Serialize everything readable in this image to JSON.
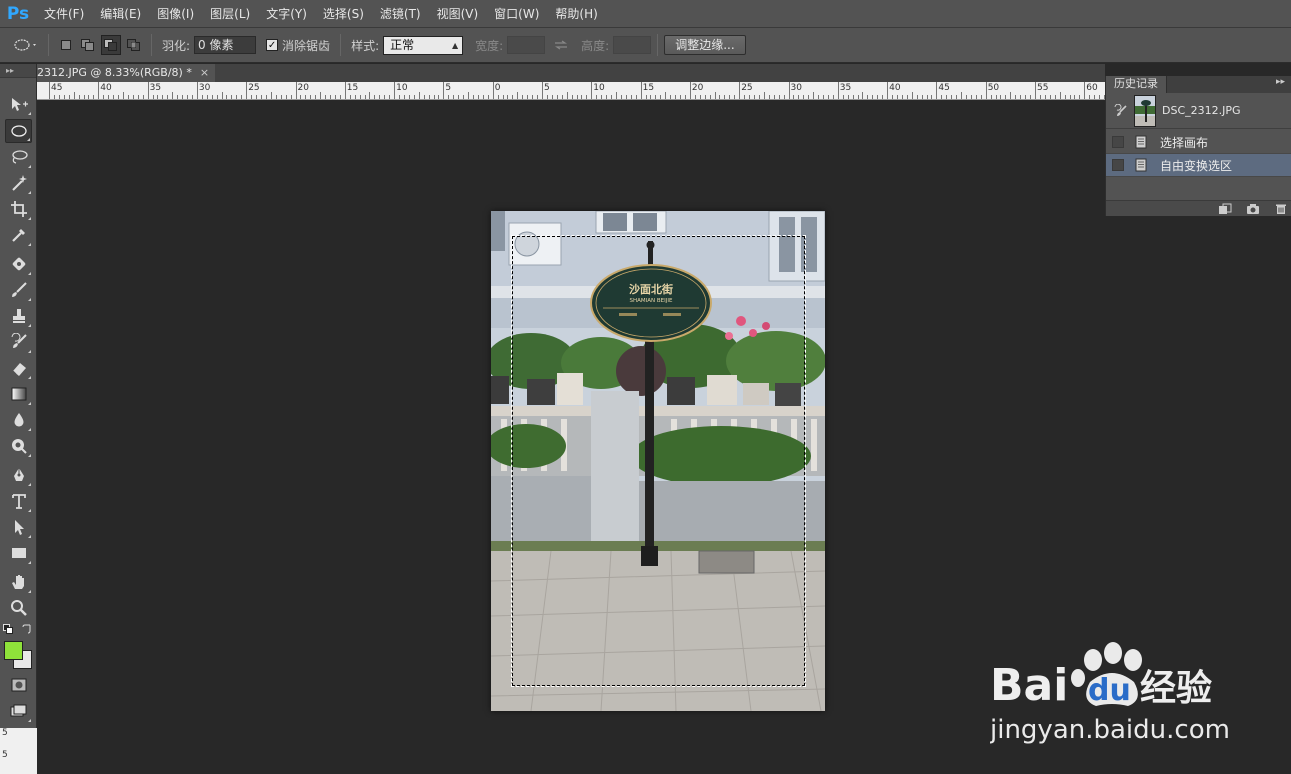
{
  "app": {
    "logo": "Ps"
  },
  "menu": [
    "文件(F)",
    "编辑(E)",
    "图像(I)",
    "图层(L)",
    "文字(Y)",
    "选择(S)",
    "滤镜(T)",
    "视图(V)",
    "窗口(W)",
    "帮助(H)"
  ],
  "options": {
    "feather_label": "羽化:",
    "feather_value": "0 像素",
    "antialias_label": "消除锯齿",
    "antialias_checked": "✓",
    "style_label": "样式:",
    "style_value": "正常",
    "width_label": "宽度:",
    "height_label": "高度:",
    "refine_edge_button": "调整边缘..."
  },
  "document": {
    "tab_title": "2312.JPG @ 8.33%(RGB/8) *",
    "close": "×"
  },
  "ruler": {
    "labels": [
      "45",
      "40",
      "35",
      "30",
      "25",
      "20",
      "15",
      "10",
      "5",
      "0",
      "5",
      "10",
      "15",
      "20",
      "25",
      "30",
      "35",
      "40",
      "45",
      "50",
      "55",
      "60"
    ]
  },
  "vertical_ruler_label": "5",
  "toolbar": {
    "grip": "▸▸",
    "foreground_color": "#8fe23a",
    "background_color": "#e9e9e9"
  },
  "history": {
    "tab_label": "历史记录",
    "menu_icon": "▸▸",
    "snapshot_label": "DSC_2312.JPG",
    "states": [
      {
        "label": "选择画布",
        "selected": false
      },
      {
        "label": "自由变换选区",
        "selected": true
      }
    ]
  },
  "image": {
    "sign_title": "沙面北街",
    "sign_subtitle": "SHAMIAN BEIJIE"
  },
  "watermark": {
    "brand": "Bai",
    "brand2": "du",
    "cn": "经验",
    "url": "jingyan.baidu.com"
  }
}
